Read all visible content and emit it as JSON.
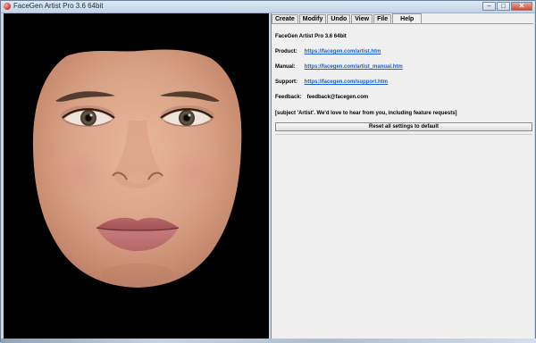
{
  "window": {
    "title": "FaceGen Artist Pro 3.6 64bit",
    "controls": {
      "minimize": "–",
      "maximize": "□",
      "close": "✕"
    }
  },
  "tabs": [
    {
      "label": "Create"
    },
    {
      "label": "Modify"
    },
    {
      "label": "Undo"
    },
    {
      "label": "View"
    },
    {
      "label": "File"
    },
    {
      "label": "Help",
      "active": true
    }
  ],
  "help": {
    "heading": "FaceGen Artist Pro 3.6 64bit",
    "product_label": "Product:",
    "product_link": "https://facegen.com/artist.htm",
    "manual_label": "Manual:",
    "manual_link": "https://facegen.com/artist_manual.htm",
    "support_label": "Support:",
    "support_link": "https://facegen.com/support.htm",
    "feedback_label": "Feedback:",
    "feedback_email": "feedback@facegen.com",
    "subject_note": "[subject 'Artist'. We'd love to hear from you, including feature requests]",
    "reset_button": "Reset all settings to default"
  },
  "colors": {
    "link": "#1a5fd0",
    "viewport_background": "#000000",
    "panel_background": "#f0f0f0"
  }
}
